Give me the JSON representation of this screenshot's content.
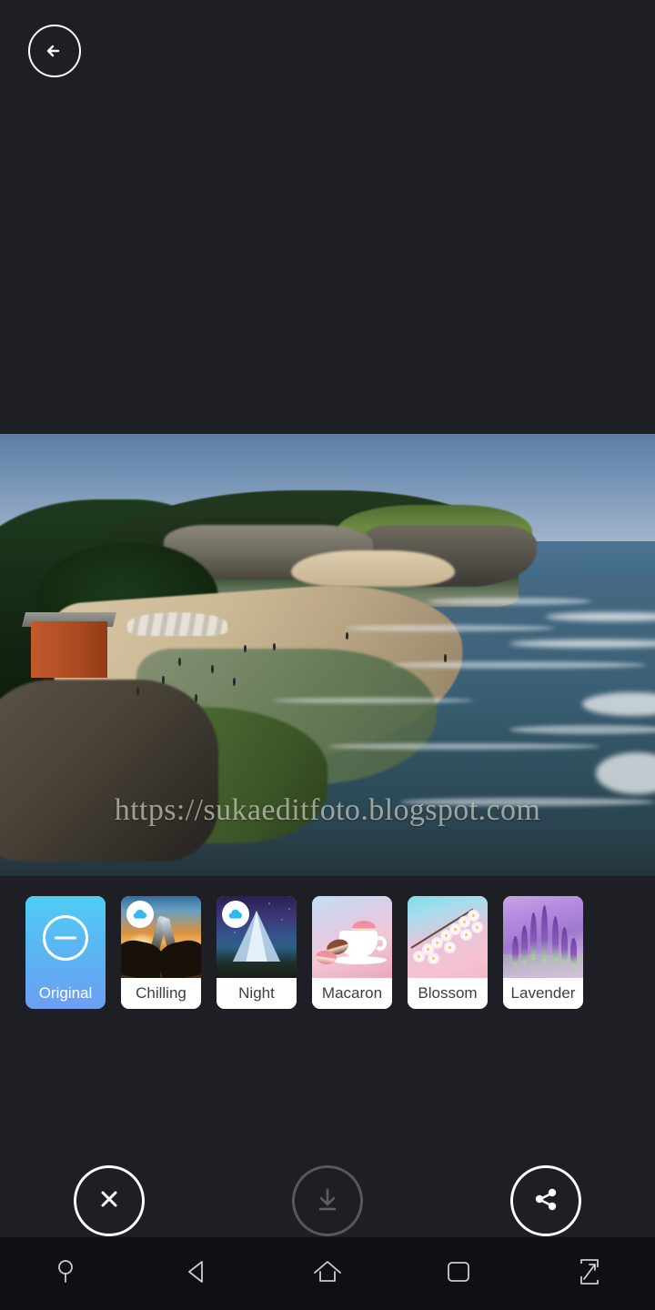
{
  "app": {
    "background_color": "#1d1f24",
    "navbar_color": "#0e1014"
  },
  "topbar": {
    "back_button_label": "Back",
    "back_icon": "arrow-left-circle-icon"
  },
  "photo": {
    "alt": "Aerial view of a tropical beach with cliffs, trees, sand and ocean waves",
    "watermark": "https://sukaeditfoto.blogspot.com"
  },
  "filters": {
    "selected": "Original",
    "items": [
      {
        "label": "Original",
        "icon": "minus-circle-icon",
        "selected": true,
        "downloadable": false,
        "thumb": "original-blue-gradient"
      },
      {
        "label": "Chilling",
        "icon": "",
        "selected": false,
        "downloadable": true,
        "thumb": "sunset-beer-cheers"
      },
      {
        "label": "Night",
        "icon": "",
        "selected": false,
        "downloadable": true,
        "thumb": "starry-night-teepee"
      },
      {
        "label": "Macaron",
        "icon": "",
        "selected": false,
        "downloadable": false,
        "thumb": "macarons-teacup"
      },
      {
        "label": "Blossom",
        "icon": "",
        "selected": false,
        "downloadable": false,
        "thumb": "cherry-blossom-branch"
      },
      {
        "label": "Lavender",
        "icon": "",
        "selected": false,
        "downloadable": false,
        "thumb": "lavender-flowers"
      }
    ],
    "download_badge_icon": "cloud-download-icon",
    "selected_tile_gradient_top": "#4fcdf5",
    "selected_tile_gradient_bottom": "#6c9ff0",
    "label_color": "#3d3f44",
    "selected_label_color": "#ffffff"
  },
  "actions": {
    "close_label": "Cancel",
    "close_icon": "close-circle-icon",
    "save_label": "Save",
    "save_icon": "download-circle-icon",
    "save_enabled": false,
    "share_label": "Share",
    "share_icon": "share-circle-icon"
  },
  "navbar": {
    "items": [
      {
        "label": "Assistant",
        "icon": "pin-icon"
      },
      {
        "label": "Back",
        "icon": "back-triangle-icon"
      },
      {
        "label": "Home",
        "icon": "home-icon"
      },
      {
        "label": "Recents",
        "icon": "recents-square-icon"
      },
      {
        "label": "Fullscreen",
        "icon": "expand-arrows-icon"
      }
    ]
  }
}
